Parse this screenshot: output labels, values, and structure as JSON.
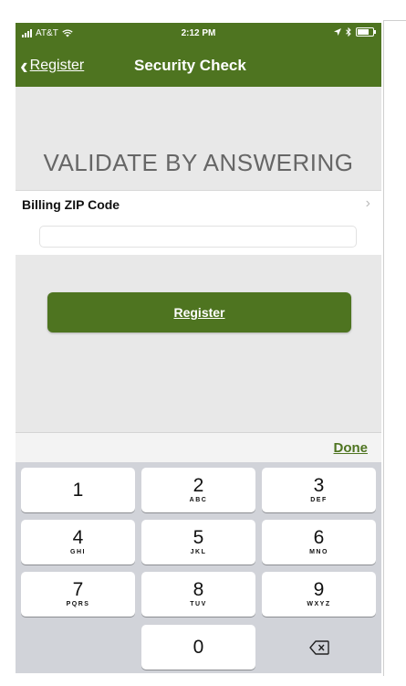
{
  "status_bar": {
    "carrier": "AT&T",
    "time": "2:12 PM"
  },
  "nav": {
    "back_label": "Register",
    "title": "Security Check"
  },
  "section_title": "VALIDATE BY ANSWERING",
  "zip_field": {
    "label": "Billing ZIP Code",
    "value": "",
    "placeholder": ""
  },
  "register_button": "Register",
  "keyboard": {
    "done": "Done",
    "keys": [
      {
        "digit": "1",
        "letters": ""
      },
      {
        "digit": "2",
        "letters": "ABC"
      },
      {
        "digit": "3",
        "letters": "DEF"
      },
      {
        "digit": "4",
        "letters": "GHI"
      },
      {
        "digit": "5",
        "letters": "JKL"
      },
      {
        "digit": "6",
        "letters": "MNO"
      },
      {
        "digit": "7",
        "letters": "PQRS"
      },
      {
        "digit": "8",
        "letters": "TUV"
      },
      {
        "digit": "9",
        "letters": "WXYZ"
      },
      {
        "digit": "0",
        "letters": ""
      }
    ],
    "delete_icon": "backspace-icon"
  },
  "colors": {
    "brand_green": "#4e7420",
    "keyboard_bg": "#d1d3d9",
    "background": "#e8e8e8"
  }
}
